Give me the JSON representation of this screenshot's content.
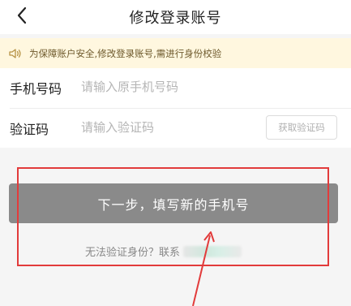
{
  "header": {
    "title": "修改登录账号",
    "back_icon": "chevron-left-icon"
  },
  "notice": {
    "text": "为保障账户安全,修改登录账号,需进行身份校验",
    "icon": "speaker-icon",
    "bg": "#fff7df"
  },
  "form": {
    "phone": {
      "label": "手机号码",
      "placeholder": "请输入原手机号码",
      "value": ""
    },
    "code": {
      "label": "验证码",
      "placeholder": "请输入验证码",
      "value": "",
      "send_label": "获取验证码"
    }
  },
  "actions": {
    "next_label": "下一步，填写新的手机号"
  },
  "help": {
    "text": "无法验证身份？联系"
  },
  "colors": {
    "annotation": "#e23b3b",
    "button": "#8a8a8a"
  }
}
